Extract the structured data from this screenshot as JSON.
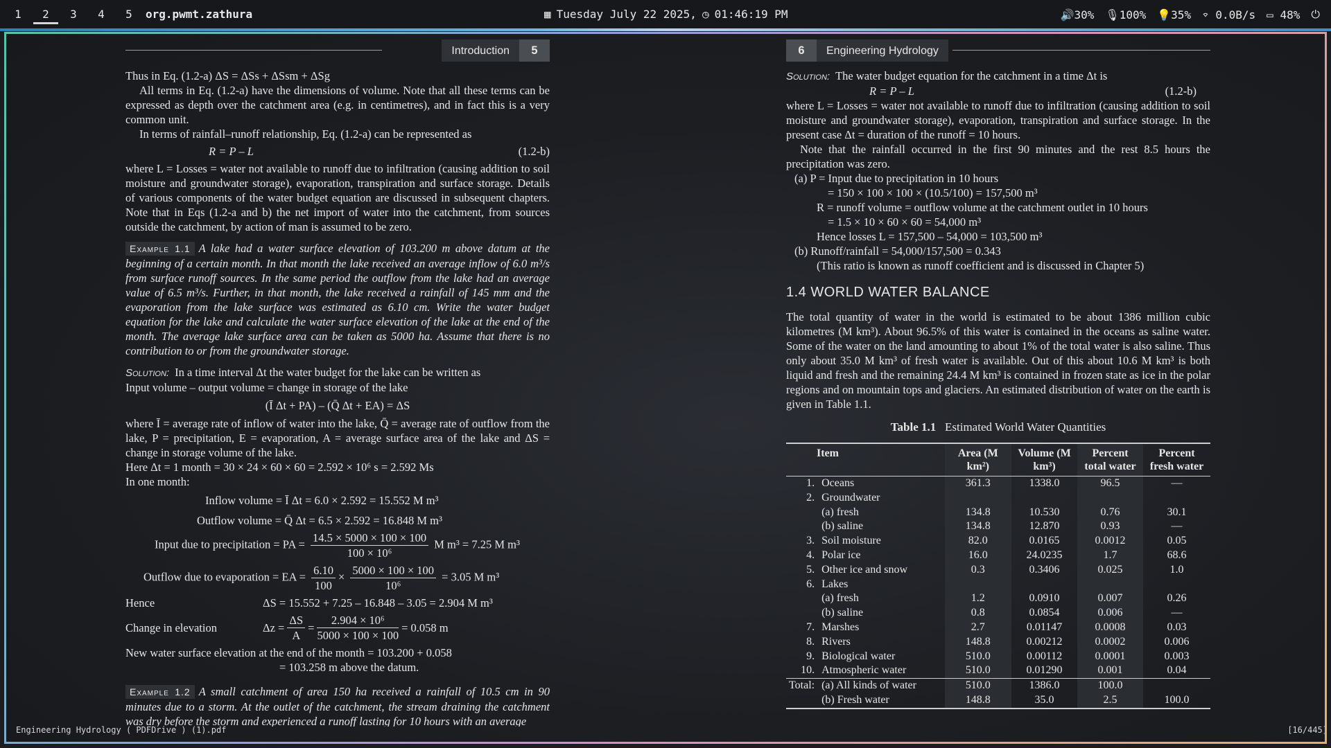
{
  "topbar": {
    "workspaces": [
      "1",
      "2",
      "3",
      "4",
      "5"
    ],
    "active_workspace": "2",
    "window_title": "org.pwmt.zathura",
    "date": "Tuesday July 22 2025,",
    "time": "01:46:19 PM",
    "volume": "30%",
    "mic": "100%",
    "brightness": "35%",
    "net": "0.0B/s",
    "battery": "48%"
  },
  "left": {
    "header_title": "Introduction",
    "header_num": "5",
    "p1": "Thus in Eq. (1.2-a) ΔS = ΔSs + ΔSsm + ΔSg",
    "p2": "All terms in Eq. (1.2-a) have the dimensions of volume. Note that all these terms can be expressed as depth over the catchment area (e.g. in centimetres), and in fact this is a very common unit.",
    "p3": "In terms of rainfall–runoff relationship, Eq. (1.2-a) can be represented as",
    "eq_lhs": "R = P – L",
    "eq_tag": "(1.2-b)",
    "p4": "where L = Losses = water not available to runoff due to infiltration (causing addition to soil moisture and groundwater storage), evaporation, transpiration and surface storage. Details of various components of the water budget equation are discussed in subsequent chapters. Note that in Eqs (1.2-a and b) the net import of water into the catchment, from sources outside the catchment, by action of man is assumed to be zero.",
    "ex1_label": "Example 1.1",
    "ex1_text": "A lake had a water surface elevation of 103.200 m above datum at the beginning of a certain month. In that month the lake received an average inflow of 6.0 m³/s from surface runoff sources. In the same period the outflow from the lake had an average value of 6.5 m³/s. Further, in that month, the lake received a rainfall of 145 mm and the evaporation from the lake surface was estimated as 6.10 cm. Write the water budget equation for the lake and calculate the water surface elevation of the lake at the end of the month. The average lake surface area can be taken as 5000 ha. Assume that there is no contribution to or from the groundwater storage.",
    "sol_label": "Solution:",
    "sol1": "In a time interval Δt the water budget for the lake can be written as",
    "sol2": "Input volume – output volume = change in storage of the lake",
    "sol_eq": "(Ī Δt + PA) – (Q̄ Δt + EA) = ΔS",
    "sol3": "where Ī = average rate of inflow of water into the lake, Q̄ = average rate of outflow from the lake, P = precipitation, E = evaporation, A = average surface area of the lake and ΔS = change in storage volume of the lake.",
    "sol4": "Here    Δt = 1 month = 30 × 24 × 60 × 60 = 2.592 × 10⁶ s = 2.592 Ms",
    "sol5": "In one month:",
    "inflow": "Inflow volume = Ī Δt = 6.0 × 2.592 = 15.552 M m³",
    "outflow": "Outflow volume = Q̄ Δt = 6.5 × 2.592 = 16.848 M m³",
    "precip_lbl": "Input due to precipitation = PA =",
    "precip_num": "14.5 × 5000 × 100 × 100",
    "precip_den": "100 × 10⁶",
    "precip_res": "M m³ = 7.25 M m³",
    "evap_lbl": "Outflow due to evaporation = EA =",
    "evap_n1": "6.10",
    "evap_d1": "100",
    "evap_n2": "5000 × 100 × 100",
    "evap_d2": "10⁶",
    "evap_res": "= 3.05 M m³",
    "hence_lbl": "Hence",
    "hence_val": "ΔS = 15.552 + 7.25 – 16.848 – 3.05 = 2.904 M m³",
    "elev_lbl": "Change in elevation",
    "elev_pre": "Δz =",
    "elev_n1": "ΔS",
    "elev_d1": "A",
    "elev_n2": "2.904 × 10⁶",
    "elev_d2": "5000 × 100 × 100",
    "elev_res": "= 0.058 m",
    "new1": "New water surface elevation at the end of the month = 103.200 + 0.058",
    "new2": "= 103.258 m above the datum.",
    "ex2_label": "Example 1.2",
    "ex2_text": "A small catchment of area 150 ha received a rainfall of 10.5 cm in 90 minutes due to a storm. At the outlet of the catchment, the stream draining the catchment was dry before the storm and experienced a runoff lasting for 10 hours with an average"
  },
  "right": {
    "header_num": "6",
    "header_title": "Engineering Hydrology",
    "sol_label": "Solution:",
    "s1": "The water budget equation for the catchment in a time Δt is",
    "eq": "R = P – L",
    "eq_tag": "(1.2-b)",
    "s2": "where L = Losses = water not available to runoff due to infiltration (causing addition to soil moisture and groundwater storage), evaporation, transpiration and surface storage. In the present case Δt = duration of the runoff = 10 hours.",
    "s3": "Note that the rainfall occurred in the first 90 minutes and the rest 8.5 hours the precipitation was zero.",
    "a1": "(a)  P = Input due to precipitation in 10 hours",
    "a2": "= 150 × 100 × 100 × (10.5/100) = 157,500 m³",
    "a3": "R = runoff volume = outflow volume at the catchment outlet in 10 hours",
    "a4": "= 1.5 × 10 × 60 × 60 = 54,000 m³",
    "a5": "Hence losses L = 157,500 – 54,000 = 103,500 m³",
    "b1": "(b)  Runoff/rainfall = 54,000/157,500 = 0.343",
    "b2": "(This ratio is known as runoff coefficient and is discussed in Chapter 5)",
    "section": "1.4   WORLD WATER BALANCE",
    "p1": "The total quantity of water in the world is estimated to be about 1386 million cubic kilometres (M km³). About 96.5% of this water is contained in the oceans as saline water. Some of the water on the land amounting to about 1% of the total water is also saline. Thus only about 35.0 M km³ of fresh water is available. Out of this about 10.6 M km³ is both liquid and fresh and the remaining 24.4 M km³ is contained in frozen state as ice in the polar regions and on mountain tops and glaciers. An estimated distribution of water on the earth is given in Table 1.1.",
    "table_label": "Table 1.1",
    "table_title": "Estimated World Water Quantities",
    "columns": [
      "Item",
      "Area (M km²)",
      "Volume (M km³)",
      "Percent total water",
      "Percent fresh water"
    ],
    "rows": [
      [
        "1.",
        "Oceans",
        "361.3",
        "1338.0",
        "96.5",
        "—"
      ],
      [
        "2.",
        "Groundwater",
        "",
        "",
        "",
        ""
      ],
      [
        "",
        "(a)  fresh",
        "134.8",
        "10.530",
        "0.76",
        "30.1"
      ],
      [
        "",
        "(b)  saline",
        "134.8",
        "12.870",
        "0.93",
        "—"
      ],
      [
        "3.",
        "Soil moisture",
        "82.0",
        "0.0165",
        "0.0012",
        "0.05"
      ],
      [
        "4.",
        "Polar ice",
        "16.0",
        "24.0235",
        "1.7",
        "68.6"
      ],
      [
        "5.",
        "Other ice and snow",
        "0.3",
        "0.3406",
        "0.025",
        "1.0"
      ],
      [
        "6.",
        "Lakes",
        "",
        "",
        "",
        ""
      ],
      [
        "",
        "(a)  fresh",
        "1.2",
        "0.0910",
        "0.007",
        "0.26"
      ],
      [
        "",
        "(b)  saline",
        "0.8",
        "0.0854",
        "0.006",
        "—"
      ],
      [
        "7.",
        "Marshes",
        "2.7",
        "0.01147",
        "0.0008",
        "0.03"
      ],
      [
        "8.",
        "Rivers",
        "148.8",
        "0.00212",
        "0.0002",
        "0.006"
      ],
      [
        "9.",
        "Biological water",
        "510.0",
        "0.00112",
        "0.0001",
        "0.003"
      ],
      [
        "10.",
        "Atmospheric water",
        "510.0",
        "0.01290",
        "0.001",
        "0.04"
      ]
    ],
    "totals": [
      [
        "Total:",
        "(a)  All kinds of water",
        "510.0",
        "1386.0",
        "100.0",
        ""
      ],
      [
        "",
        "(b)  Fresh water",
        "148.8",
        "35.0",
        "2.5",
        "100.0"
      ]
    ]
  },
  "statusbar": {
    "filename": "Engineering Hydrology ( PDFDrive ) (1).pdf",
    "page": "[16/445]"
  }
}
